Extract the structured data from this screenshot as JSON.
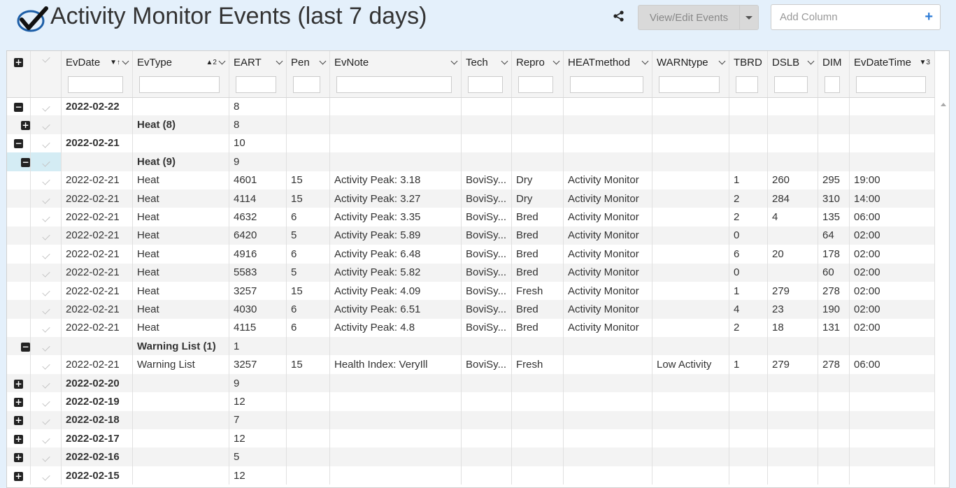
{
  "header": {
    "title": "Activity Monitor Events (last 7 days)",
    "view_edit_label": "View/Edit Events",
    "add_column_placeholder": "Add Column"
  },
  "columns": [
    {
      "key": "evdate",
      "label": "EvDate",
      "sort": "▼↑"
    },
    {
      "key": "evtype",
      "label": "EvType",
      "sort": "▲2"
    },
    {
      "key": "eart",
      "label": "EART"
    },
    {
      "key": "pen",
      "label": "Pen"
    },
    {
      "key": "evnote",
      "label": "EvNote"
    },
    {
      "key": "tech",
      "label": "Tech"
    },
    {
      "key": "repro",
      "label": "Repro"
    },
    {
      "key": "heat",
      "label": "HEATmethod"
    },
    {
      "key": "warn",
      "label": "WARNtype"
    },
    {
      "key": "tbrd",
      "label": "TBRD"
    },
    {
      "key": "dslb",
      "label": "DSLB"
    },
    {
      "key": "dim",
      "label": "DIM"
    },
    {
      "key": "evdt",
      "label": "EvDateTime",
      "sort": "▼3"
    }
  ],
  "rows": [
    {
      "kind": "g1",
      "toggle": "−",
      "evdate": "2022-02-22",
      "eart": "8"
    },
    {
      "kind": "g2",
      "toggle": "+",
      "evtype": "Heat (8)",
      "eart": "8"
    },
    {
      "kind": "g1",
      "toggle": "−",
      "evdate": "2022-02-21",
      "eart": "10"
    },
    {
      "kind": "g2",
      "toggle": "−",
      "evtype": "Heat (9)",
      "eart": "9",
      "selected": true
    },
    {
      "kind": "d",
      "evdate": "2022-02-21",
      "evtype": "Heat",
      "eart": "4601",
      "pen": "15",
      "evnote": "Activity Peak: 3.18",
      "tech": "BoviSy...",
      "repro": "Dry",
      "heat": "Activity Monitor",
      "warn": "",
      "tbrd": "1",
      "dslb": "260",
      "dim": "295",
      "evdt": "19:00"
    },
    {
      "kind": "d",
      "evdate": "2022-02-21",
      "evtype": "Heat",
      "eart": "4114",
      "pen": "15",
      "evnote": "Activity Peak: 3.27",
      "tech": "BoviSy...",
      "repro": "Dry",
      "heat": "Activity Monitor",
      "warn": "",
      "tbrd": "2",
      "dslb": "284",
      "dim": "310",
      "evdt": "14:00"
    },
    {
      "kind": "d",
      "evdate": "2022-02-21",
      "evtype": "Heat",
      "eart": "4632",
      "pen": "6",
      "evnote": "Activity Peak: 3.35",
      "tech": "BoviSy...",
      "repro": "Bred",
      "heat": "Activity Monitor",
      "warn": "",
      "tbrd": "2",
      "dslb": "4",
      "dim": "135",
      "evdt": "06:00"
    },
    {
      "kind": "d",
      "evdate": "2022-02-21",
      "evtype": "Heat",
      "eart": "6420",
      "pen": "5",
      "evnote": "Activity Peak: 5.89",
      "tech": "BoviSy...",
      "repro": "Bred",
      "heat": "Activity Monitor",
      "warn": "",
      "tbrd": "0",
      "dslb": "",
      "dim": "64",
      "evdt": "02:00"
    },
    {
      "kind": "d",
      "evdate": "2022-02-21",
      "evtype": "Heat",
      "eart": "4916",
      "pen": "6",
      "evnote": "Activity Peak: 6.48",
      "tech": "BoviSy...",
      "repro": "Bred",
      "heat": "Activity Monitor",
      "warn": "",
      "tbrd": "6",
      "dslb": "20",
      "dim": "178",
      "evdt": "02:00"
    },
    {
      "kind": "d",
      "evdate": "2022-02-21",
      "evtype": "Heat",
      "eart": "5583",
      "pen": "5",
      "evnote": "Activity Peak: 5.82",
      "tech": "BoviSy...",
      "repro": "Bred",
      "heat": "Activity Monitor",
      "warn": "",
      "tbrd": "0",
      "dslb": "",
      "dim": "60",
      "evdt": "02:00"
    },
    {
      "kind": "d",
      "evdate": "2022-02-21",
      "evtype": "Heat",
      "eart": "3257",
      "pen": "15",
      "evnote": "Activity Peak: 4.09",
      "tech": "BoviSy...",
      "repro": "Fresh",
      "heat": "Activity Monitor",
      "warn": "",
      "tbrd": "1",
      "dslb": "279",
      "dim": "278",
      "evdt": "02:00"
    },
    {
      "kind": "d",
      "evdate": "2022-02-21",
      "evtype": "Heat",
      "eart": "4030",
      "pen": "6",
      "evnote": "Activity Peak: 6.51",
      "tech": "BoviSy...",
      "repro": "Bred",
      "heat": "Activity Monitor",
      "warn": "",
      "tbrd": "4",
      "dslb": "23",
      "dim": "190",
      "evdt": "02:00"
    },
    {
      "kind": "d",
      "evdate": "2022-02-21",
      "evtype": "Heat",
      "eart": "4115",
      "pen": "6",
      "evnote": "Activity Peak: 4.8",
      "tech": "BoviSy...",
      "repro": "Bred",
      "heat": "Activity Monitor",
      "warn": "",
      "tbrd": "2",
      "dslb": "18",
      "dim": "131",
      "evdt": "02:00"
    },
    {
      "kind": "g2",
      "toggle": "−",
      "evtype": "Warning List (1)",
      "eart": "1"
    },
    {
      "kind": "d",
      "evdate": "2022-02-21",
      "evtype": "Warning List",
      "eart": "3257",
      "pen": "15",
      "evnote": "Health Index: VeryIll",
      "tech": "BoviSy...",
      "repro": "Fresh",
      "heat": "",
      "warn": "Low Activity",
      "tbrd": "1",
      "dslb": "279",
      "dim": "278",
      "evdt": "06:00"
    },
    {
      "kind": "g1",
      "toggle": "+",
      "evdate": "2022-02-20",
      "eart": "9"
    },
    {
      "kind": "g1",
      "toggle": "+",
      "evdate": "2022-02-19",
      "eart": "12"
    },
    {
      "kind": "g1",
      "toggle": "+",
      "evdate": "2022-02-18",
      "eart": "7"
    },
    {
      "kind": "g1",
      "toggle": "+",
      "evdate": "2022-02-17",
      "eart": "12"
    },
    {
      "kind": "g1",
      "toggle": "+",
      "evdate": "2022-02-16",
      "eart": "5"
    },
    {
      "kind": "g1",
      "toggle": "+",
      "evdate": "2022-02-15",
      "eart": "12"
    }
  ]
}
